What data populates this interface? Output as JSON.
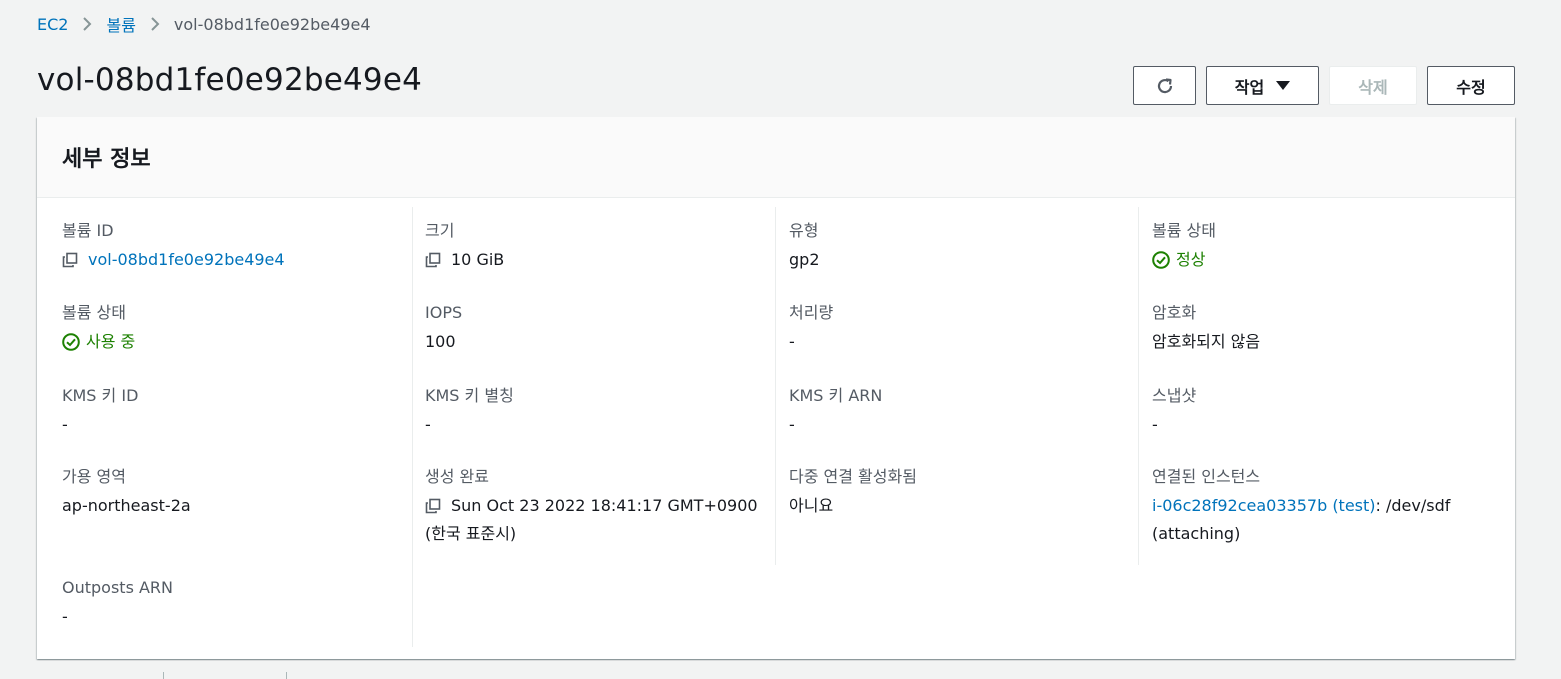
{
  "breadcrumb": {
    "root": "EC2",
    "section": "볼륨",
    "current": "vol-08bd1fe0e92be49e4"
  },
  "page": {
    "title": "vol-08bd1fe0e92be49e4"
  },
  "toolbar": {
    "actions_label": "작업",
    "delete_label": "삭제",
    "edit_label": "수정"
  },
  "panel": {
    "title": "세부 정보"
  },
  "details": {
    "volume_id": {
      "label": "볼륨 ID",
      "value": "vol-08bd1fe0e92be49e4"
    },
    "size": {
      "label": "크기",
      "value": "10 GiB"
    },
    "type": {
      "label": "유형",
      "value": "gp2"
    },
    "volume_status": {
      "label": "볼륨 상태",
      "value": "정상"
    },
    "volume_state": {
      "label": "볼륨 상태",
      "value": "사용 중"
    },
    "iops": {
      "label": "IOPS",
      "value": "100"
    },
    "throughput": {
      "label": "처리량",
      "value": "-"
    },
    "encryption": {
      "label": "암호화",
      "value": "암호화되지 않음"
    },
    "kms_key_id": {
      "label": "KMS 키 ID",
      "value": "-"
    },
    "kms_key_alias": {
      "label": "KMS 키 별칭",
      "value": "-"
    },
    "kms_key_arn": {
      "label": "KMS 키 ARN",
      "value": "-"
    },
    "snapshot": {
      "label": "스냅샷",
      "value": "-"
    },
    "availability_zone": {
      "label": "가용 영역",
      "value": "ap-northeast-2a"
    },
    "created": {
      "label": "생성 완료",
      "value_line1": "Sun Oct 23 2022 18:41:17 GMT+0900",
      "value_line2": "(한국 표준시)"
    },
    "multi_attach": {
      "label": "다중 연결 활성화됨",
      "value": "아니요"
    },
    "attached_instances": {
      "label": "연결된 인스턴스",
      "instance_link": "i-06c28f92cea03357b (test)",
      "device": ": /dev/sdf",
      "state": "(attaching)"
    },
    "outposts_arn": {
      "label": "Outposts ARN",
      "value": "-"
    }
  },
  "colors": {
    "link": "#0073bb",
    "success": "#1d8102",
    "label": "#545b64"
  },
  "icons": {
    "copy": "copy-icon",
    "status_ok": "check-circle-icon",
    "refresh": "refresh-icon",
    "breadcrumb_separator": "chevron-right-icon"
  }
}
